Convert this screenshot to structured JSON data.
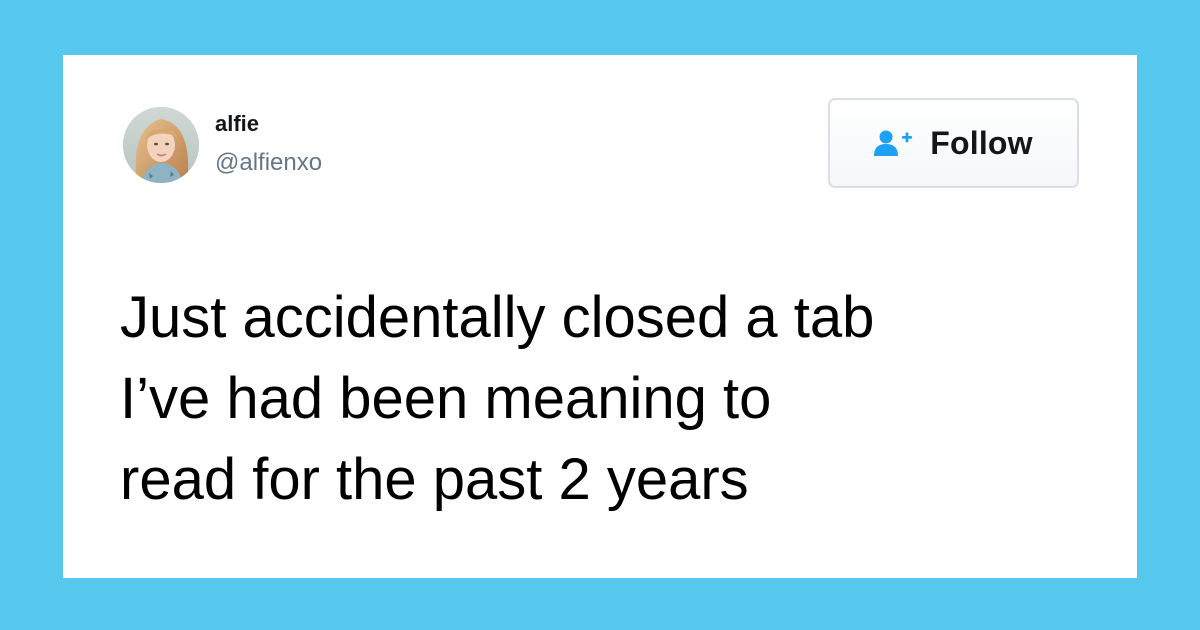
{
  "author": {
    "name": "alfie",
    "handle": "@alfienxo"
  },
  "follow_button": {
    "label": "Follow",
    "icon": "add-user-icon"
  },
  "tweet": {
    "text": "Just accidentally closed a tab\nI’ve had been meaning to\nread for the past 2 years"
  },
  "colors": {
    "background": "#56c8ee",
    "card": "#ffffff",
    "accent": "#1da1f2",
    "handle": "#657786"
  }
}
